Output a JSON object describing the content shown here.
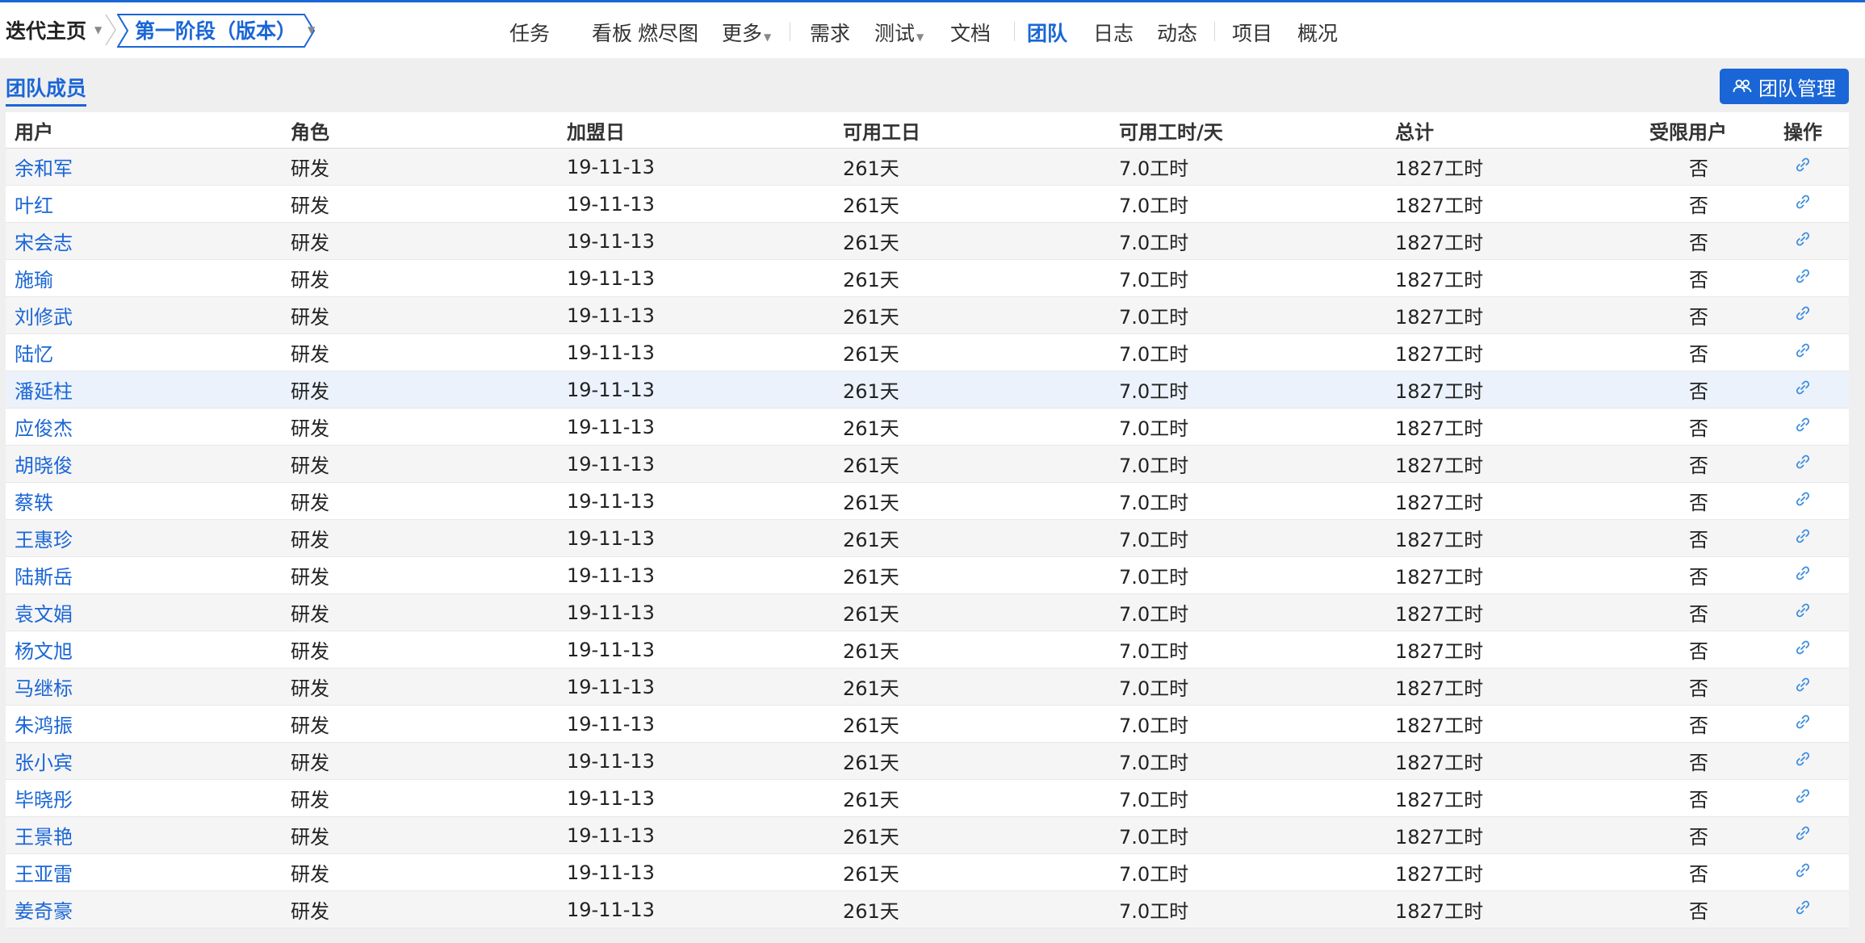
{
  "breadcrumb": {
    "home_label": "迭代主页",
    "current_label": "第一阶段（版本）"
  },
  "nav": {
    "items": [
      "任务",
      "看板",
      "燃尽图",
      "更多",
      "需求",
      "测试",
      "文档",
      "团队",
      "日志",
      "动态",
      "项目",
      "概况"
    ],
    "active": "团队"
  },
  "section": {
    "title": "团队成员",
    "manage_button": "团队管理"
  },
  "table": {
    "headers": [
      "用户",
      "角色",
      "加盟日",
      "可用工日",
      "可用工时/天",
      "总计",
      "受限用户",
      "操作"
    ],
    "rows": [
      [
        "余和军",
        "研发",
        "19-11-13",
        "261天",
        "7.0工时",
        "1827工时",
        "否"
      ],
      [
        "叶红",
        "研发",
        "19-11-13",
        "261天",
        "7.0工时",
        "1827工时",
        "否"
      ],
      [
        "宋会志",
        "研发",
        "19-11-13",
        "261天",
        "7.0工时",
        "1827工时",
        "否"
      ],
      [
        "施瑜",
        "研发",
        "19-11-13",
        "261天",
        "7.0工时",
        "1827工时",
        "否"
      ],
      [
        "刘修武",
        "研发",
        "19-11-13",
        "261天",
        "7.0工时",
        "1827工时",
        "否"
      ],
      [
        "陆忆",
        "研发",
        "19-11-13",
        "261天",
        "7.0工时",
        "1827工时",
        "否"
      ],
      [
        "潘延柱",
        "研发",
        "19-11-13",
        "261天",
        "7.0工时",
        "1827工时",
        "否"
      ],
      [
        "应俊杰",
        "研发",
        "19-11-13",
        "261天",
        "7.0工时",
        "1827工时",
        "否"
      ],
      [
        "胡晓俊",
        "研发",
        "19-11-13",
        "261天",
        "7.0工时",
        "1827工时",
        "否"
      ],
      [
        "蔡轶",
        "研发",
        "19-11-13",
        "261天",
        "7.0工时",
        "1827工时",
        "否"
      ],
      [
        "王惠珍",
        "研发",
        "19-11-13",
        "261天",
        "7.0工时",
        "1827工时",
        "否"
      ],
      [
        "陆斯岳",
        "研发",
        "19-11-13",
        "261天",
        "7.0工时",
        "1827工时",
        "否"
      ],
      [
        "袁文娟",
        "研发",
        "19-11-13",
        "261天",
        "7.0工时",
        "1827工时",
        "否"
      ],
      [
        "杨文旭",
        "研发",
        "19-11-13",
        "261天",
        "7.0工时",
        "1827工时",
        "否"
      ],
      [
        "马继标",
        "研发",
        "19-11-13",
        "261天",
        "7.0工时",
        "1827工时",
        "否"
      ],
      [
        "朱鸿振",
        "研发",
        "19-11-13",
        "261天",
        "7.0工时",
        "1827工时",
        "否"
      ],
      [
        "张小宾",
        "研发",
        "19-11-13",
        "261天",
        "7.0工时",
        "1827工时",
        "否"
      ],
      [
        "毕晓彤",
        "研发",
        "19-11-13",
        "261天",
        "7.0工时",
        "1827工时",
        "否"
      ],
      [
        "王景艳",
        "研发",
        "19-11-13",
        "261天",
        "7.0工时",
        "1827工时",
        "否"
      ],
      [
        "王亚雷",
        "研发",
        "19-11-13",
        "261天",
        "7.0工时",
        "1827工时",
        "否"
      ],
      [
        "姜奇豪",
        "研发",
        "19-11-13",
        "261天",
        "7.0工时",
        "1827工时",
        "否"
      ]
    ],
    "highlighted_row": 6
  },
  "icons": {
    "link": "link-icon",
    "team": "team-icon",
    "dropdown": "chevron-down-icon"
  },
  "colors": {
    "accent": "#1a66d6",
    "row_alt": "#f5f5f5",
    "row_highlight": "#ebf2fb"
  }
}
